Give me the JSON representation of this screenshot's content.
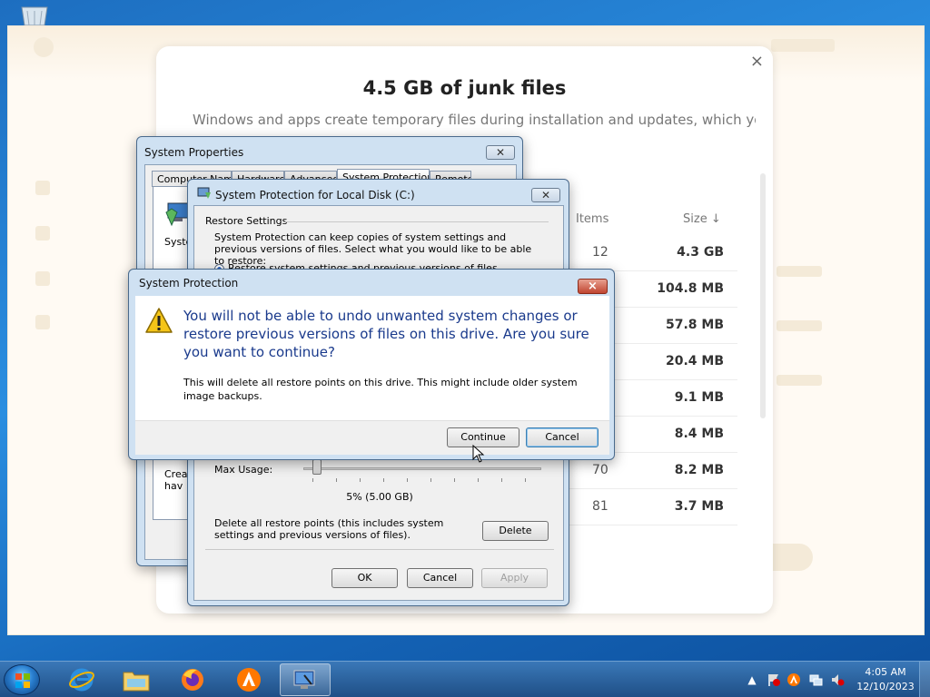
{
  "desktop": {
    "recycle_bin_icon": "recycle-bin-icon"
  },
  "avast_card": {
    "title": "4.5 GB of junk files",
    "subtitle": "Windows and apps create temporary files during installation and updates, which you no",
    "close_glyph": "×",
    "col_items": "Items",
    "col_size": "Size ↓",
    "rows": [
      {
        "items": "12",
        "size": "4.3 GB"
      },
      {
        "items": "",
        "size": "104.8 MB"
      },
      {
        "items": "",
        "size": "57.8 MB"
      },
      {
        "items": "",
        "size": "20.4 MB"
      },
      {
        "items": "",
        "size": "9.1 MB"
      },
      {
        "items": "",
        "size": "8.4 MB"
      },
      {
        "items": "70",
        "size": "8.2 MB"
      },
      {
        "items": "81",
        "size": "3.7 MB"
      }
    ]
  },
  "system_properties": {
    "title": "System Properties",
    "tabs": [
      "Computer Name",
      "Hardware",
      "Advanced",
      "System Protection",
      "Remote"
    ],
    "side_text_1": "Syster",
    "side_text_2": "Crea",
    "side_text_3": "hav"
  },
  "protection_dialog": {
    "title": "System Protection for Local Disk (C:)",
    "restore_settings": "Restore Settings",
    "description": "System Protection can keep copies of system settings and previous versions of files. Select what you would like to be able to restore:",
    "radio_label": "Restore system settings and previous versions of files",
    "max_usage_label": "Max Usage:",
    "usage_value": "5% (5.00 GB)",
    "usage_fraction": 0.05,
    "delete_text": "Delete all restore points (this includes system settings and previous versions of files).",
    "delete_button": "Delete",
    "ok_button": "OK",
    "cancel_button": "Cancel",
    "apply_button": "Apply"
  },
  "confirm_dialog": {
    "title": "System Protection",
    "main_instruction": "You will not be able to undo unwanted system changes or restore previous versions of files on this drive. Are you sure you want to continue?",
    "detail": "This will delete all restore points on this drive. This might include older system image backups.",
    "continue_button": "Continue",
    "cancel_button": "Cancel",
    "close_glyph": "×"
  },
  "taskbar": {
    "start_icon": "windows-start-icon",
    "apps": [
      "internet-explorer-icon",
      "file-explorer-icon",
      "firefox-icon",
      "avast-icon",
      "system-properties-icon"
    ],
    "time": "4:05 AM",
    "date": "12/10/2023",
    "tray_icons": [
      "show-hidden-icons-chevron",
      "action-center-flag-icon",
      "avast-tray-icon",
      "network-icon",
      "volume-muted-icon"
    ]
  },
  "colors": {
    "instruction_blue": "#1a3a8c",
    "taskbar": "#1f4f86",
    "avast_bg": "#fffaf3"
  }
}
